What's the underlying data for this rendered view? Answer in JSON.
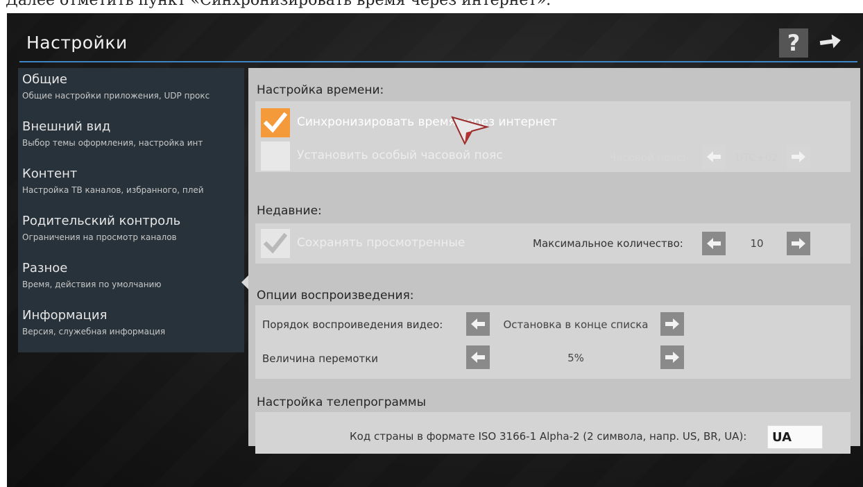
{
  "caption": "Далее отметить пункт «Синхронизировать время через интернет».",
  "header": {
    "title": "Настройки",
    "help_glyph": "?"
  },
  "sidebar": {
    "items": [
      {
        "title": "Общие",
        "subtitle": "Общие настройки приложения, UDP прокс"
      },
      {
        "title": "Внешний вид",
        "subtitle": "Выбор темы оформления, настройка инт"
      },
      {
        "title": "Контент",
        "subtitle": "Настройка ТВ каналов, избранного, плей"
      },
      {
        "title": "Родительский контроль",
        "subtitle": "Ограничения на просмотр каналов"
      },
      {
        "title": "Разное",
        "subtitle": "Время, действия по умолчанию"
      },
      {
        "title": "Информация",
        "subtitle": "Версия, служебная информация"
      }
    ],
    "selected_index": 4
  },
  "time": {
    "title": "Настройка времени:",
    "sync_label": "Синхронизировать время через интернет",
    "sync_checked": true,
    "tz_label": "Установить особый часовой пояс",
    "tz_checked": false,
    "tz_field_label": "Часовой пояс:",
    "tz_value": "UTC+02"
  },
  "recent": {
    "title": "Недавние:",
    "save_label": "Сохранять просмотренные",
    "save_checked": true,
    "max_label": "Максимальное количество:",
    "max_value": "10"
  },
  "playback": {
    "title": "Опции воспроизведения:",
    "order_label": "Порядок воспроиведения видео:",
    "order_value": "Остановка в конце списка",
    "seek_label": "Величина перемотки",
    "seek_value": "5%"
  },
  "epg": {
    "title": "Настройка телепрограммы",
    "country_label": "Код страны в формате ISO 3166-1 Alpha-2 (2 символа, напр. US, BR, UA):",
    "country_value": "UA"
  },
  "colors": {
    "accent_blue": "#3c86c8",
    "checkbox_orange": "#f59a3a",
    "sidebar_bg": "#27323a",
    "panel_bg": "#c4c4c4"
  }
}
